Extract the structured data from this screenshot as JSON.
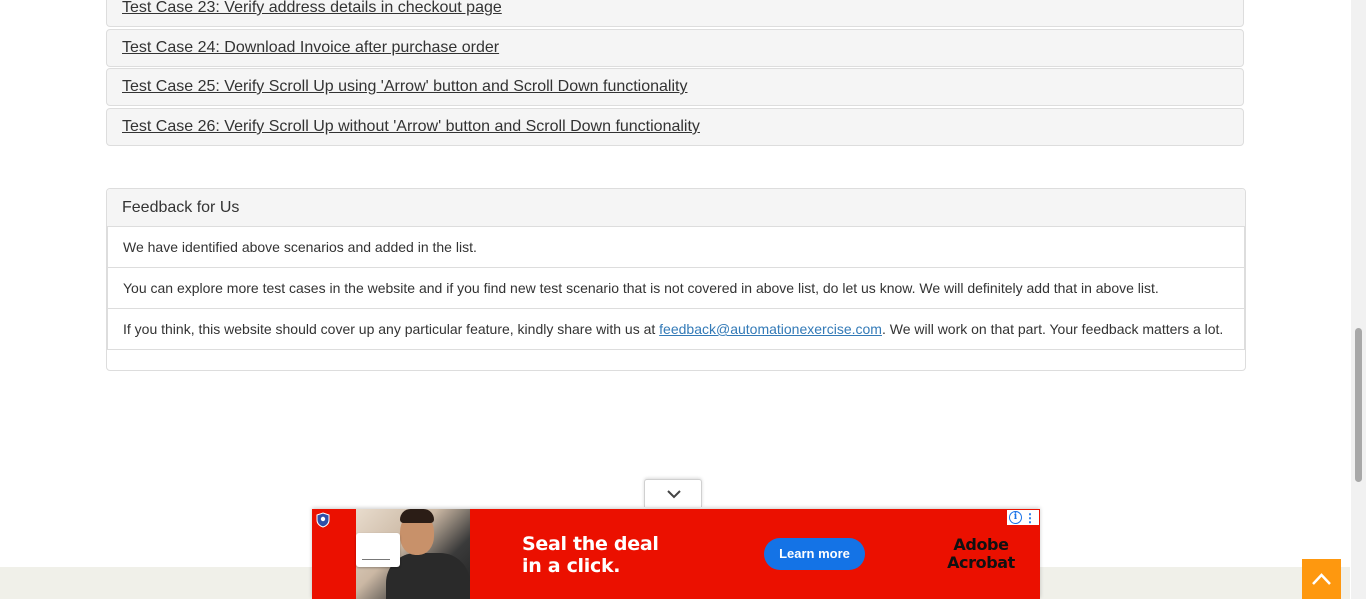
{
  "test_cases": [
    {
      "label": "Test Case 23: Verify address details in checkout page"
    },
    {
      "label": "Test Case 24: Download Invoice after purchase order"
    },
    {
      "label": "Test Case 25: Verify Scroll Up using 'Arrow' button and Scroll Down functionality"
    },
    {
      "label": "Test Case 26: Verify Scroll Up without 'Arrow' button and Scroll Down functionality"
    }
  ],
  "feedback": {
    "title": "Feedback for Us",
    "line1": "We have identified above scenarios and added in the list.",
    "line2": "You can explore more test cases in the website and if you find new test scenario that is not covered in above list, do let us know. We will definitely add that in above list.",
    "line3_before": "If you think, this website should cover up any particular feature, kindly share with us at ",
    "email": "feedback@automationexercise.com",
    "line3_after": ". We will work on that part. Your feedback matters a lot."
  },
  "ad": {
    "headline_line1": "Seal the deal",
    "headline_line2": "in a click.",
    "cta": "Learn more",
    "brand_line1": "Adobe",
    "brand_line2": "Acrobat",
    "background_color": "#eb1000",
    "cta_color": "#1473e6"
  },
  "colors": {
    "scroll_up_button": "#fe980f",
    "footer_band": "#f0f0e9",
    "link": "#337ab7"
  },
  "icons": {
    "ad_collapse": "chevron-down-icon",
    "scroll_up": "chevron-up-icon",
    "ad_info": "info-icon",
    "ad_more": "more-vertical-icon",
    "ad_shield": "shield-icon"
  }
}
